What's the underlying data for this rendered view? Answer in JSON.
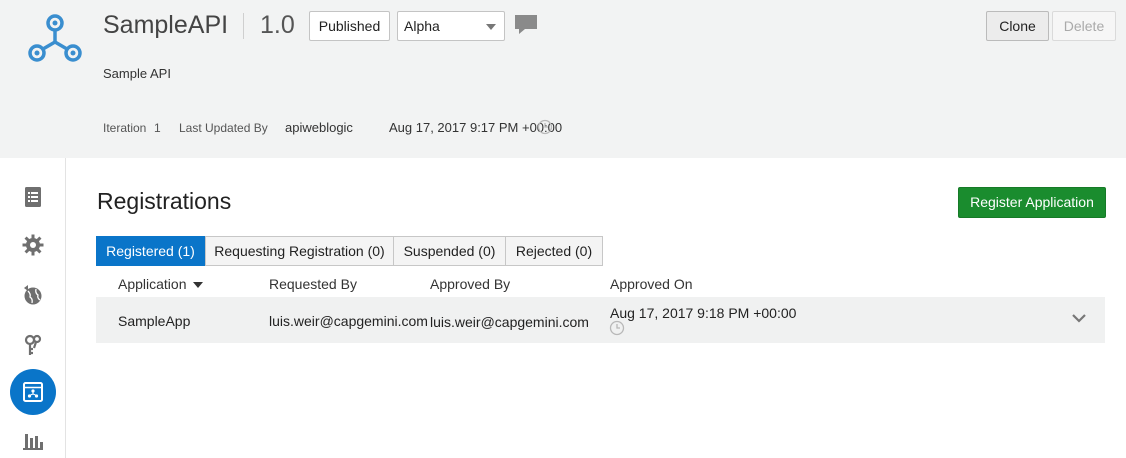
{
  "header": {
    "api_name": "SampleAPI",
    "version": "1.0",
    "status": "Published",
    "stage": {
      "selected": "Alpha"
    },
    "description": "Sample API",
    "clone_label": "Clone",
    "delete_label": "Delete",
    "meta": {
      "iteration_label": "Iteration",
      "iteration_value": "1",
      "updated_by_label": "Last Updated By",
      "updated_by_value": "apiweblogic",
      "updated_on": "Aug 17, 2017 9:17 PM +00:00"
    },
    "icons": {
      "logo": "api-hub-logo",
      "comment": "comment-icon",
      "clock": "clock-icon"
    }
  },
  "leftnav": {
    "items": [
      {
        "icon": "document-list-icon",
        "active": false
      },
      {
        "icon": "gear-icon",
        "active": false
      },
      {
        "icon": "globe-icon",
        "active": false
      },
      {
        "icon": "keys-icon",
        "active": false
      },
      {
        "icon": "registrations-icon",
        "active": true
      },
      {
        "icon": "bar-chart-icon",
        "active": false
      }
    ]
  },
  "main": {
    "title": "Registrations",
    "register_button_label": "Register Application",
    "tabs": [
      {
        "label": "Registered (1)",
        "active": true
      },
      {
        "label": "Requesting Registration (0)",
        "active": false
      },
      {
        "label": "Suspended (0)",
        "active": false
      },
      {
        "label": "Rejected (0)",
        "active": false
      }
    ],
    "columns": [
      "Application",
      "Requested By",
      "Approved By",
      "Approved On"
    ],
    "rows": [
      {
        "application": "SampleApp",
        "requested_by": "luis.weir@capgemini.com",
        "approved_by": "luis.weir@capgemini.com",
        "approved_on": "Aug 17, 2017 9:18 PM +00:00"
      }
    ]
  },
  "colors": {
    "accent": "#0a75c9",
    "primary_button": "#1a8c2e",
    "header_bg": "#f2f3f3",
    "row_bg": "#f0f1f1"
  }
}
